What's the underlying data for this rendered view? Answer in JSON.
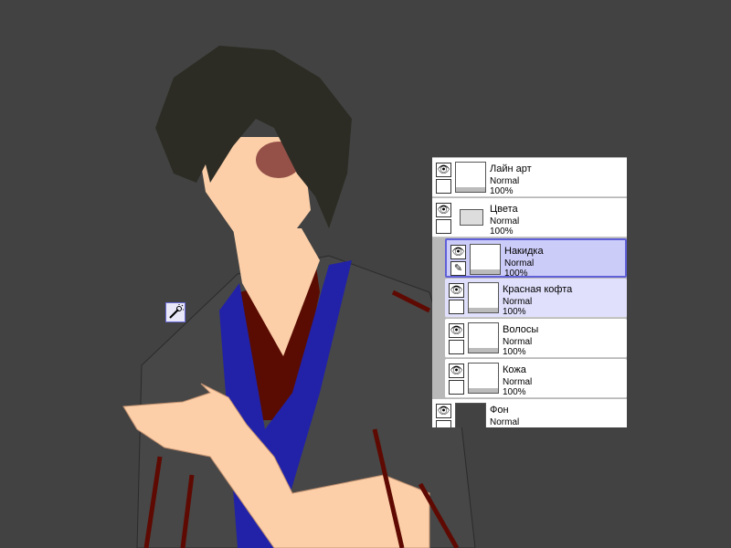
{
  "tool": {
    "icon": "magic-wand-icon"
  },
  "layers": [
    {
      "name": "Лайн арт",
      "mode": "Normal",
      "opacity": "100%",
      "visible": true
    },
    {
      "name": "Цвета",
      "mode": "Normal",
      "opacity": "100%",
      "visible": true,
      "type": "folder"
    },
    {
      "name": "Накидка",
      "mode": "Normal",
      "opacity": "100%",
      "visible": true,
      "selected": true
    },
    {
      "name": "Красная кофта",
      "mode": "Normal",
      "opacity": "100%",
      "visible": true
    },
    {
      "name": "Волосы",
      "mode": "Normal",
      "opacity": "100%",
      "visible": true
    },
    {
      "name": "Кожа",
      "mode": "Normal",
      "opacity": "100%",
      "visible": true
    },
    {
      "name": "Фон",
      "mode": "Normal",
      "visible": true
    }
  ],
  "colors": {
    "canvas": "#424242",
    "selected_layer": "#ccccf8",
    "accent": "#6060d8"
  }
}
